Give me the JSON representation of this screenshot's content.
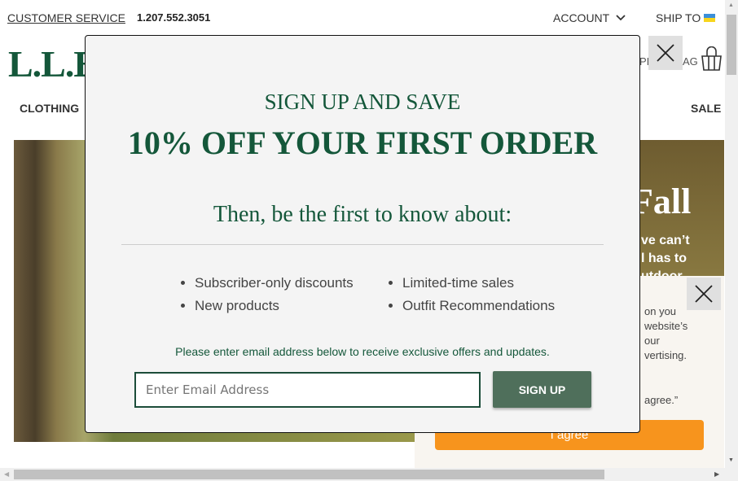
{
  "topbar": {
    "customer_service": "CUSTOMER SERVICE",
    "phone": "1.207.552.3051",
    "account": "ACCOUNT",
    "ship_to": "SHIP TO"
  },
  "header": {
    "logo": "L.L.B",
    "bag_partial_left": "PI",
    "bag_partial_right": "AG"
  },
  "nav": {
    "items": [
      {
        "label": "CLOTHING"
      },
      {
        "label": "SALE"
      }
    ]
  },
  "hero": {
    "title_partial": "Fall",
    "lines": [
      "ve can’t",
      "l has to",
      "utdoor"
    ]
  },
  "cookie": {
    "lines": [
      "on you",
      "website’s",
      "our",
      "vertising.",
      "agree.”"
    ],
    "button": "I agree"
  },
  "modal": {
    "heading": "SIGN UP AND SAVE",
    "offer": "10% OFF YOUR FIRST ORDER",
    "subheading": "Then, be the first to know about:",
    "benefits_left": [
      "Subscriber-only discounts",
      "New products"
    ],
    "benefits_right": [
      "Limited-time sales",
      "Outfit Recommendations"
    ],
    "instruction": "Please enter email address below to receive exclusive offers and updates.",
    "email_placeholder": "Enter Email Address",
    "signup": "SIGN UP"
  },
  "colors": {
    "brand_green": "#14573a",
    "signup_button": "#4f6f5b",
    "cookie_button": "#f7941d"
  }
}
